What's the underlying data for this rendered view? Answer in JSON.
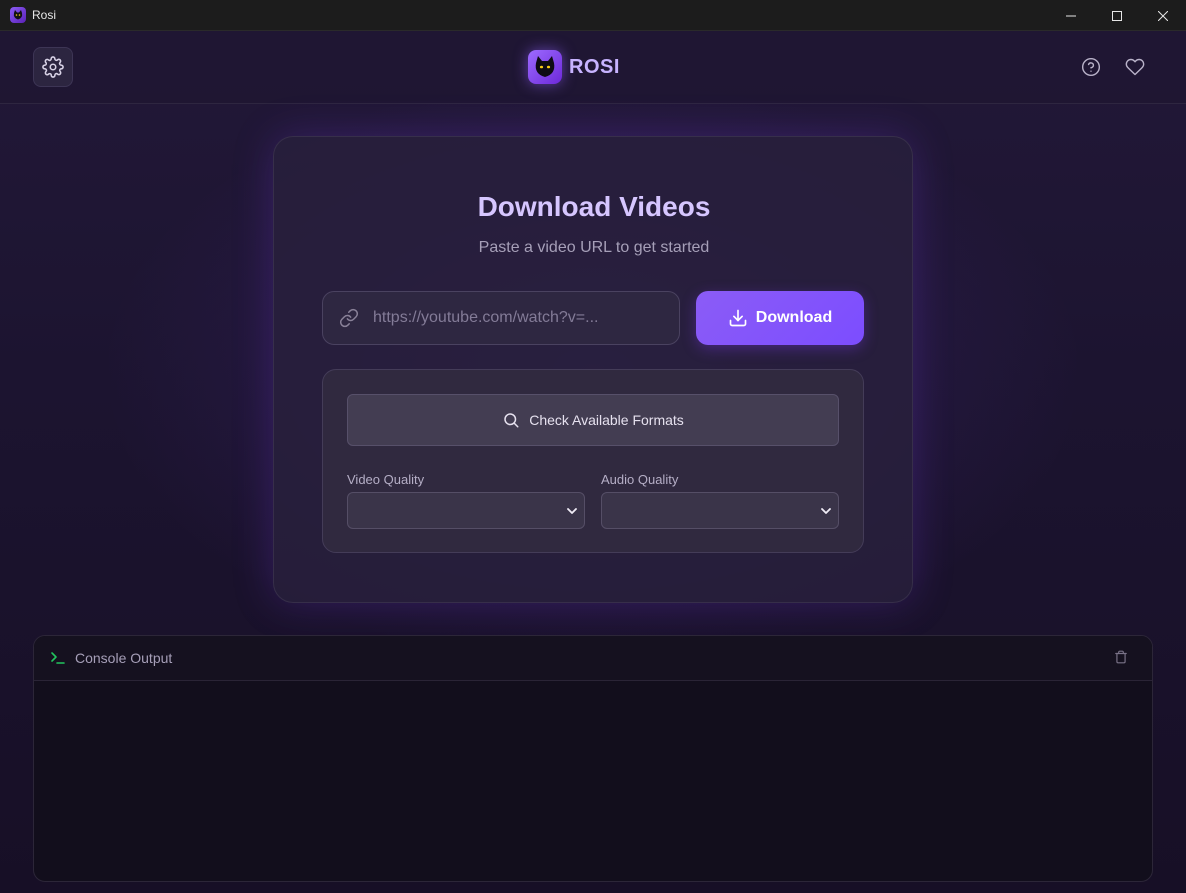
{
  "window": {
    "title": "Rosi",
    "controls": [
      "minimize",
      "maximize",
      "close"
    ]
  },
  "header": {
    "brand_name": "ROSI",
    "icons": [
      "gear-icon",
      "help-circle-icon",
      "heart-icon"
    ]
  },
  "main": {
    "title": "Download Videos",
    "subtitle": "Paste a video URL to get started",
    "url_input": {
      "value": "",
      "placeholder": "https://youtube.com/watch?v=..."
    },
    "download_label": "Download",
    "check_formats_label": "Check Available Formats",
    "video_quality": {
      "label": "Video Quality",
      "selected": ""
    },
    "audio_quality": {
      "label": "Audio Quality",
      "selected": ""
    }
  },
  "console": {
    "title": "Console Output"
  },
  "colors": {
    "accent": "#8b5cf6",
    "brand_text": "#c7b3ff",
    "terminal_icon": "#22c55e"
  }
}
